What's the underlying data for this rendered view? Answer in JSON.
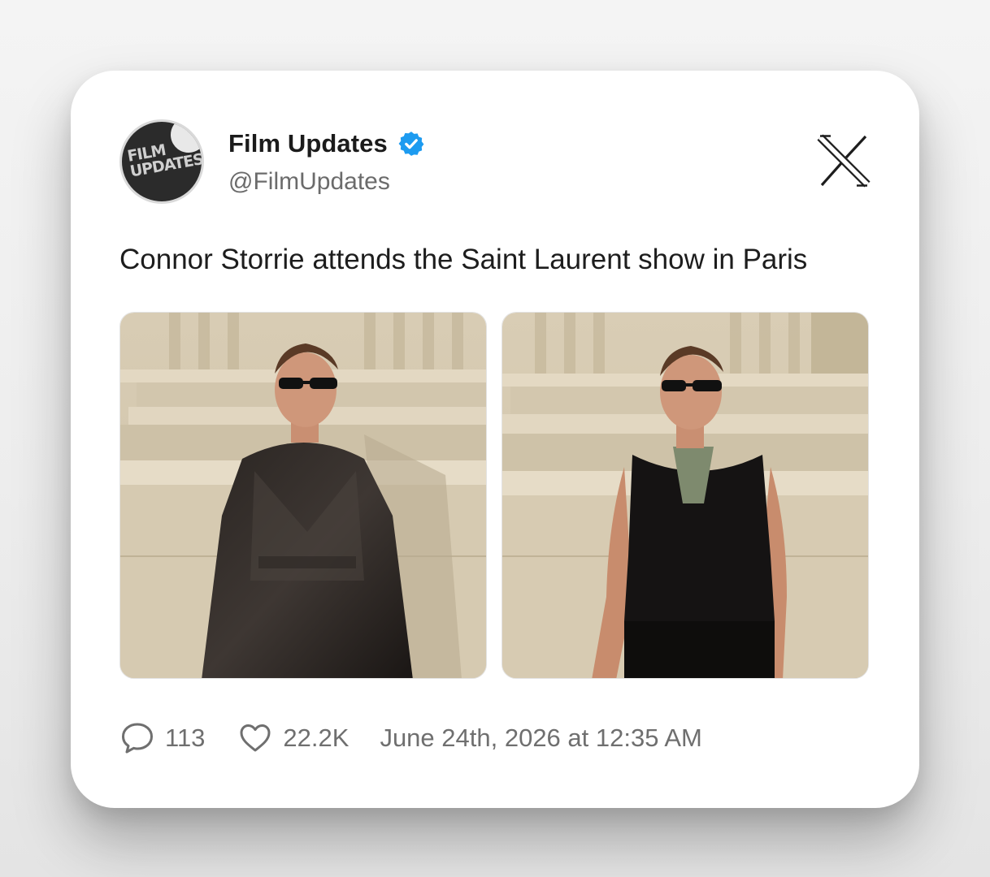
{
  "tweet": {
    "author_name": "Film Updates",
    "handle": "@FilmUpdates",
    "verified": true,
    "avatar_text_line1": "FILM",
    "avatar_text_line2": "UPDATES",
    "text": "Connor Storrie attends the Saint Laurent show in Paris",
    "media": [
      {
        "kind": "photo",
        "subject": "man in black sunglasses and glossy black trench coat in front of stone columns"
      },
      {
        "kind": "photo",
        "subject": "man in black sunglasses, black knit tank top and sequined scarf in front of stone columns"
      }
    ],
    "replies": "113",
    "likes": "22.2K",
    "timestamp": "June 24th, 2026 at 12:35 AM"
  },
  "icons": {
    "verified": "verified-badge-icon",
    "platform": "x-logo-icon",
    "reply": "speech-bubble-icon",
    "like": "heart-icon"
  },
  "colors": {
    "verified_blue": "#1d9bf0",
    "text_primary": "#1b1b1b",
    "text_secondary": "#6b6b6b"
  }
}
